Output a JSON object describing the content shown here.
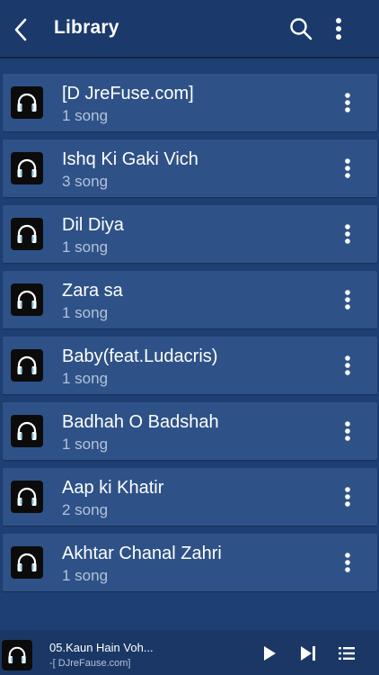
{
  "header": {
    "title": "Library",
    "back_icon": "chevron-left-icon",
    "search_icon": "search-icon",
    "menu_icon": "more-vertical-icon"
  },
  "library": {
    "items": [
      {
        "title": "[D JreFuse.com]",
        "subtitle": "1 song"
      },
      {
        "title": "Ishq Ki Gaki Vich",
        "subtitle": "3 song"
      },
      {
        "title": "Dil Diya",
        "subtitle": "1 song"
      },
      {
        "title": "Zara sa",
        "subtitle": "1 song"
      },
      {
        "title": "Baby(feat.Ludacris)",
        "subtitle": "1 song"
      },
      {
        "title": "Badhah O Badshah",
        "subtitle": "1 song"
      },
      {
        "title": "Aap ki Khatir",
        "subtitle": "2 song"
      },
      {
        "title": "Akhtar Chanal Zahri",
        "subtitle": "1 song"
      }
    ]
  },
  "player": {
    "title": "05.Kaun Hain Voh...",
    "artist": "-[ DJreFause.com]",
    "play_icon": "play-icon",
    "next_icon": "skip-next-icon",
    "queue_icon": "queue-list-icon"
  },
  "colors": {
    "background": "#1e3f73",
    "header": "#1b3a6b",
    "row": "#2e5287",
    "subtext": "#b4c2d9",
    "headphone_accent": "#7ec8e8"
  }
}
